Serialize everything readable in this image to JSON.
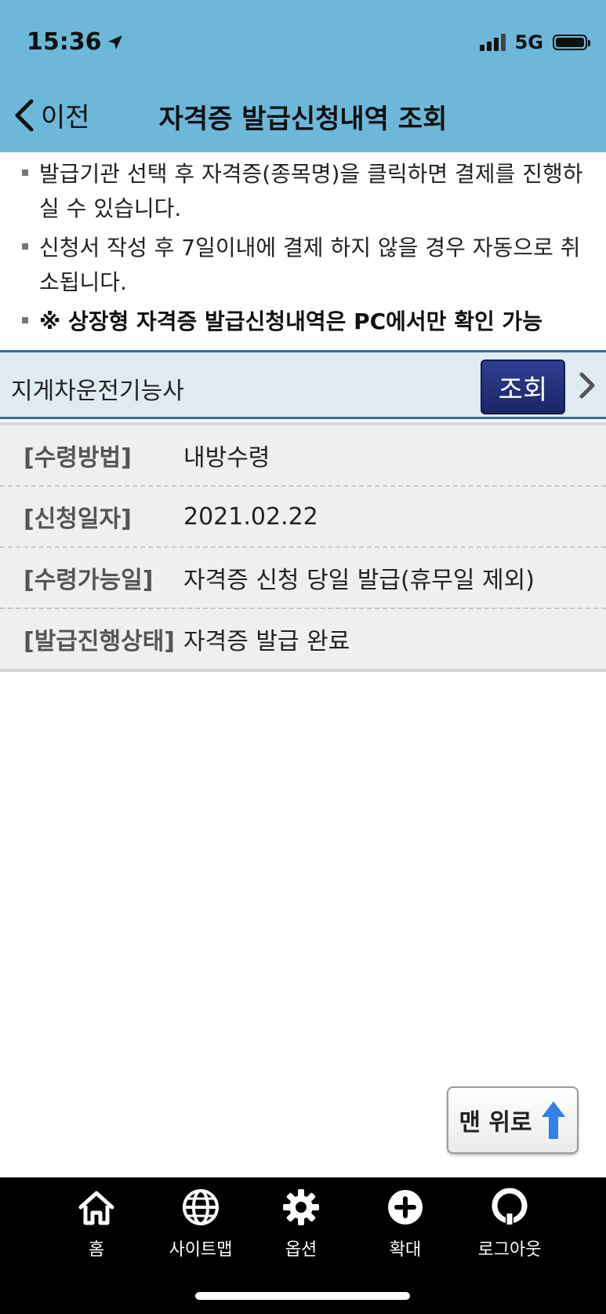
{
  "status": {
    "time": "15:36",
    "network": "5G"
  },
  "nav": {
    "back_label": "이전",
    "title": "자격증 발급신청내역 조회"
  },
  "notices": [
    "발급기관 선택 후 자격증(종목명)을 클릭하면 결제를 진행하실 수 있습니다.",
    "신청서 작성 후 7일이내에 결제 하지 않을 경우 자동으로 취소됩니다.",
    "※ 상장형 자격증 발급신청내역은 PC에서만 확인 가능"
  ],
  "selector": {
    "label": "지게차운전기능사",
    "query_button": "조회"
  },
  "info": [
    {
      "key": "[수령방법]",
      "value": "내방수령"
    },
    {
      "key": "[신청일자]",
      "value": "2021.02.22"
    },
    {
      "key": "[수령가능일]",
      "value": "자격증 신청 당일 발급(휴무일 제외)"
    },
    {
      "key": "[발급진행상태]",
      "value": "자격증 발급 완료"
    }
  ],
  "top_button": {
    "label": "맨 위로"
  },
  "tabs": [
    {
      "label": "홈",
      "icon": "home-icon"
    },
    {
      "label": "사이트맵",
      "icon": "globe-icon"
    },
    {
      "label": "옵션",
      "icon": "gear-icon"
    },
    {
      "label": "확대",
      "icon": "plus-circle-icon"
    },
    {
      "label": "로그아웃",
      "icon": "logout-icon"
    }
  ],
  "colors": {
    "header": "#6db7d9",
    "query_button": "#1f2b72",
    "accent_border": "#3a69ad",
    "up_arrow": "#2f80e8"
  }
}
